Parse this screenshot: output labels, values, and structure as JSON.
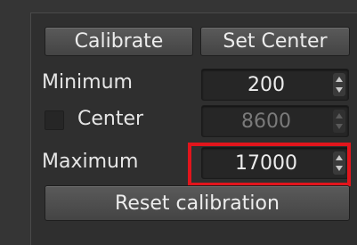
{
  "buttons": {
    "calibrate": "Calibrate",
    "set_center": "Set Center",
    "reset": "Reset calibration"
  },
  "fields": {
    "minimum": {
      "label": "Minimum",
      "value": "200"
    },
    "center": {
      "label": "Center",
      "value": "8600",
      "enabled": false,
      "checked": false
    },
    "maximum": {
      "label": "Maximum",
      "value": "17000"
    }
  },
  "icons": {
    "spin_up": "triangle-up-icon",
    "spin_down": "triangle-down-icon"
  },
  "colors": {
    "highlight": "#e2151c",
    "background": "#2f2f2f"
  }
}
